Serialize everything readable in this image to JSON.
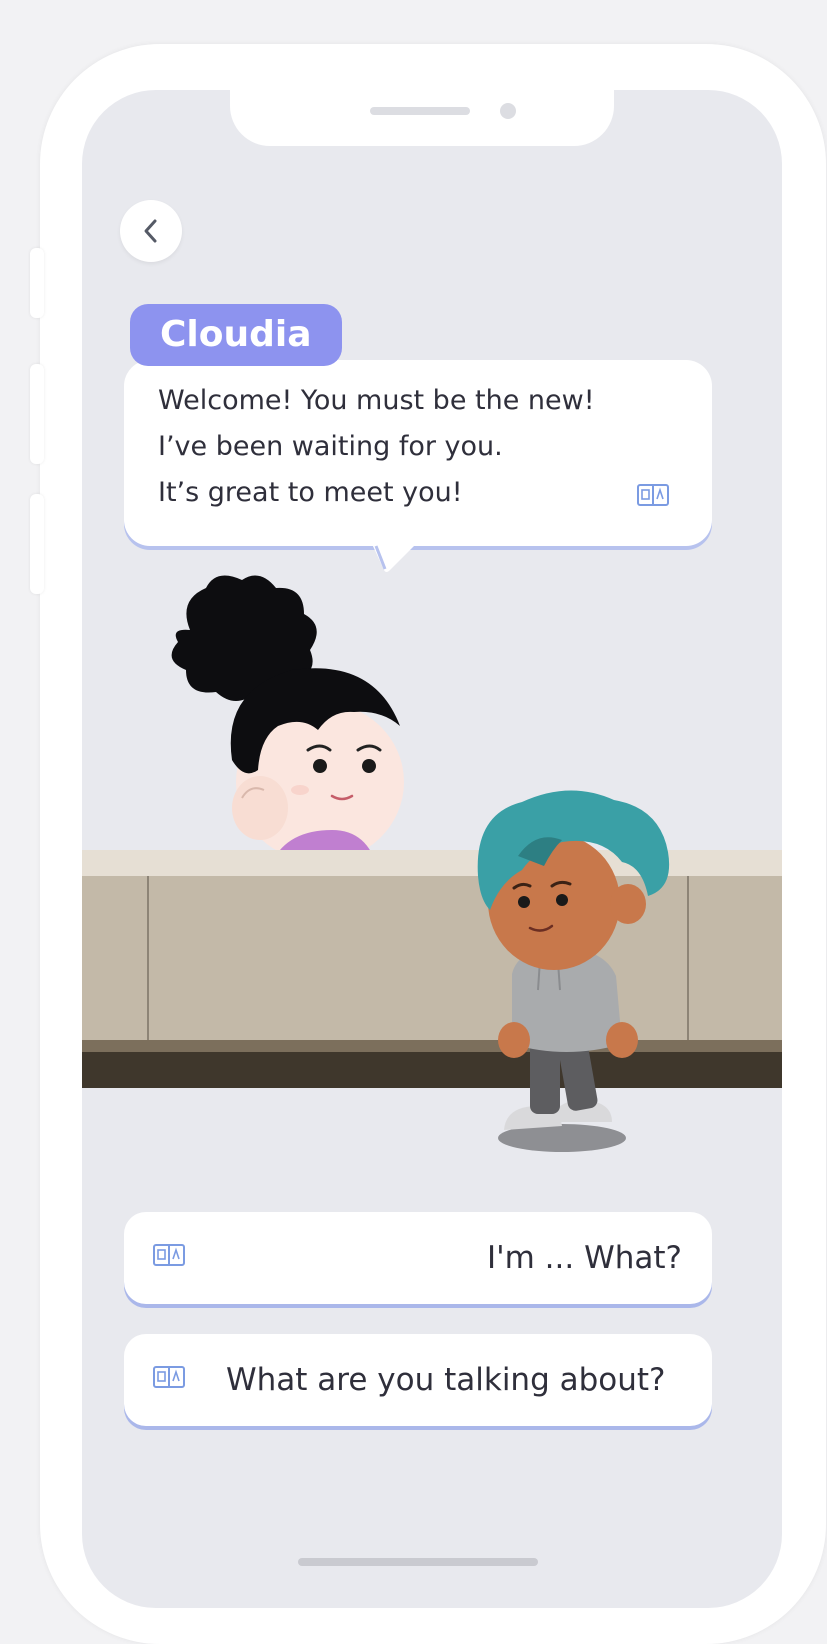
{
  "dialog": {
    "speaker_name": "Cloudia",
    "message_lines": [
      "Welcome! You must be the new!",
      "I’ve been waiting for you.",
      "It’s great to meet you!"
    ]
  },
  "answers": [
    {
      "label": "I'm ... What?"
    },
    {
      "label": "What are you talking about?"
    }
  ],
  "icons": {
    "back": "chevron-left-icon",
    "translate": "book-icon"
  },
  "colors": {
    "accent": "#8d93ef",
    "screen_bg": "#e8e9ee",
    "bubble_underline": "#b7c2ee"
  }
}
